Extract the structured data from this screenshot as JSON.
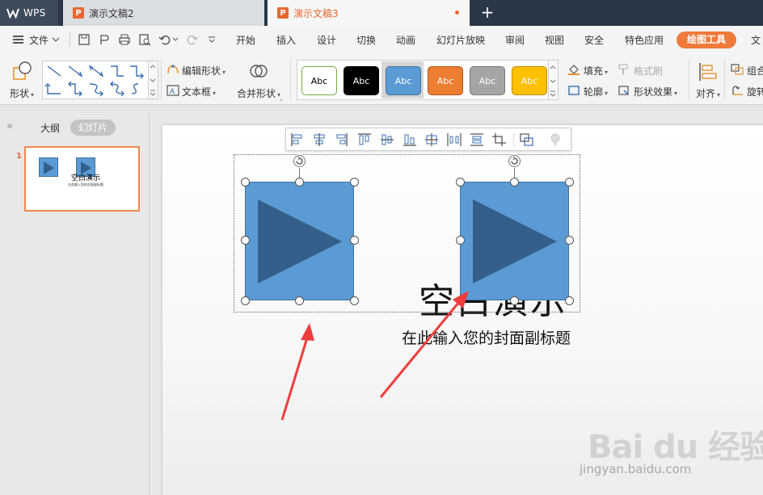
{
  "tabs": {
    "app_label": "WPS",
    "doc_inactive": "演示文稿2",
    "doc_active": "演示文稿3",
    "new_tab": "+"
  },
  "menu": {
    "file": "文件",
    "items": [
      "开始",
      "插入",
      "设计",
      "切换",
      "动画",
      "幻灯片放映",
      "审阅",
      "视图",
      "安全",
      "特色应用",
      "绘图工具",
      "文"
    ]
  },
  "ribbon": {
    "shape": "形状",
    "edit_shape": "编辑形状",
    "text_box": "文本框",
    "merge_shape": "合并形状",
    "style_boxes": [
      "Abc",
      "Abc",
      "Abc",
      "Abc",
      "Abc",
      "Abc"
    ],
    "style_colors": [
      "#ffffff",
      "#000000",
      "#5b9bd5",
      "#ed7d31",
      "#a5a5a5",
      "#ffc000"
    ],
    "style_borders": [
      "#70ad47",
      "#000000",
      "#41719c",
      "#ae5a21",
      "#787878",
      "#bc8c00"
    ],
    "style_text_colors": [
      "#000000",
      "#ffffff",
      "#ffffff",
      "#ffffff",
      "#ffffff",
      "#ffffff"
    ],
    "fill": "填充",
    "format_painter": "格式刷",
    "outline": "轮廓",
    "shape_effect": "形状效果",
    "align": "对齐",
    "group": "组合",
    "rotate": "旋转"
  },
  "left_panel": {
    "collapse": "«",
    "outline_tab": "大纲",
    "slides_tab": "幻灯片",
    "slide_number": "1",
    "thumb_title": "空白演示",
    "thumb_subtitle": "在此输入您的封面副标题"
  },
  "slide": {
    "title": "空白演示",
    "subtitle": "在此输入您的封面副标题"
  },
  "watermark": {
    "logo": "Bai du 经验",
    "url": "jingyan.baidu.com"
  },
  "colors": {
    "accent": "#ef7a3a",
    "shape_fill": "#5b9bd5",
    "shape_triangle": "#345f8a",
    "arrow": "#f03c3c"
  }
}
